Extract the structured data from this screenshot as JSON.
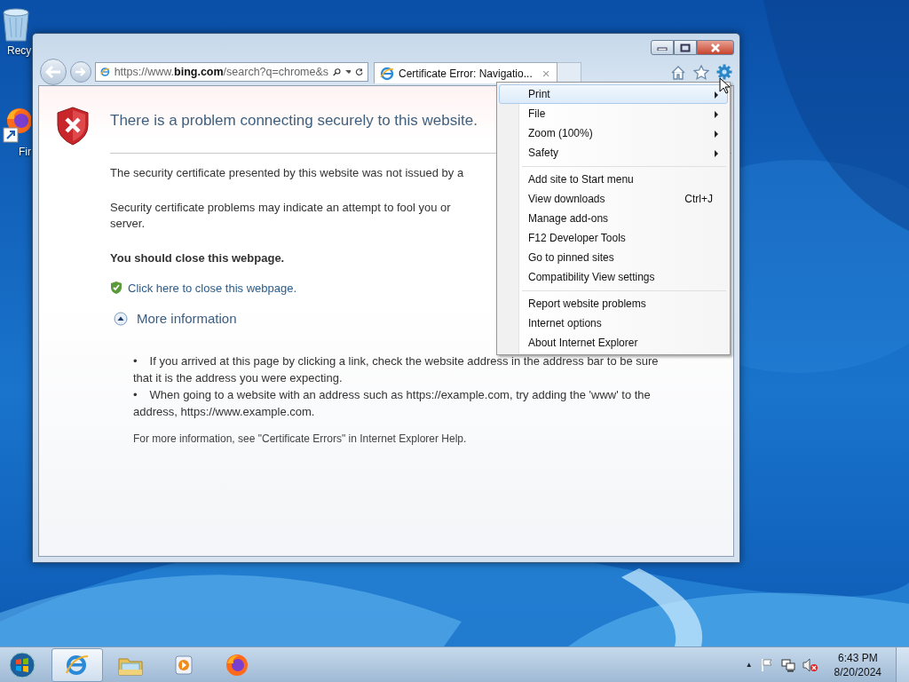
{
  "desktop_icons": [
    {
      "label": "Recy",
      "kind": "recycle"
    },
    {
      "label": "Fir",
      "kind": "firefox"
    }
  ],
  "browser": {
    "address": "https://www.**bing.com**/search?q=chrome&s",
    "tabs": [
      {
        "title": "Certificate Error: Navigatio...",
        "close": "×",
        "selected": true
      }
    ],
    "page": {
      "heading": "There is a problem connecting securely to this website.",
      "paragraphs": [
        [
          "The security certificate presented by this website was not issued by a"
        ],
        [
          "Security certificate problems may indicate an attempt to fool you or",
          "server."
        ]
      ],
      "warning": "You should close this webpage.",
      "close_link": "Click here to close this webpage.",
      "more_info": {
        "label": "More information",
        "expanded": true
      },
      "bullets": [
        {
          "marker": "•",
          "text": "If you arrived at this page by clicking a link, check the website address in the address bar to be sure that it is the address you were expecting."
        },
        {
          "marker": "•",
          "text": "When going to a website with an address such as https://example.com, try adding the 'www' to the address, https://www.example.com."
        }
      ],
      "footer": "For more information, see \"Certificate Errors\" in Internet Explorer Help."
    }
  },
  "tools_menu": {
    "groups": [
      [
        {
          "label": "Print",
          "submenu": true,
          "selected": true
        },
        {
          "label": "File",
          "submenu": true,
          "selected": false
        },
        {
          "label": "Zoom (100%)",
          "submenu": true,
          "selected": false
        },
        {
          "label": "Safety",
          "submenu": true,
          "selected": false
        }
      ],
      [
        {
          "label": "Add site to Start menu",
          "submenu": false,
          "selected": false
        },
        {
          "label": "View downloads",
          "shortcut": "Ctrl+J",
          "submenu": false,
          "selected": false
        },
        {
          "label": "Manage add-ons",
          "submenu": false,
          "selected": false
        },
        {
          "label": "F12 Developer Tools",
          "submenu": false,
          "selected": false
        },
        {
          "label": "Go to pinned sites",
          "submenu": false,
          "selected": false
        },
        {
          "label": "Compatibility View settings",
          "submenu": false,
          "selected": false
        }
      ],
      [
        {
          "label": "Report website problems",
          "submenu": false,
          "selected": false
        },
        {
          "label": "Internet options",
          "submenu": false,
          "selected": false
        },
        {
          "label": "About Internet Explorer",
          "submenu": false,
          "selected": false
        }
      ]
    ]
  },
  "taskbar": {
    "apps": [
      {
        "kind": "ie",
        "selected": true
      },
      {
        "kind": "explorer",
        "selected": false
      },
      {
        "kind": "media",
        "selected": false
      },
      {
        "kind": "firefox",
        "selected": false
      }
    ],
    "tray": {
      "show_hidden": "▲",
      "time": "6:43 PM",
      "date": "8/20/2024"
    }
  }
}
